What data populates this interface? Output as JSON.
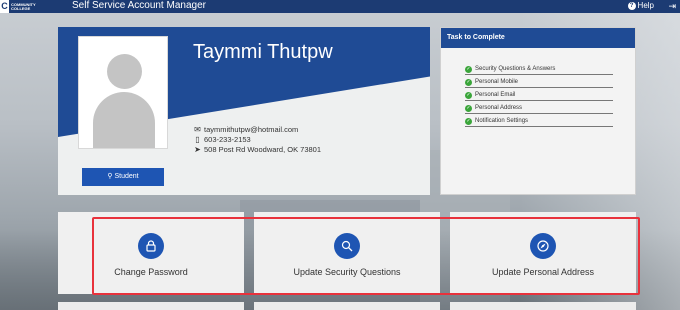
{
  "header": {
    "logo_line1": "COMMUNITY",
    "logo_line2": "COLLEGE",
    "logo_mark": "C",
    "title": "Self Service Account Manager",
    "help_label": "Help"
  },
  "profile": {
    "name": "Taymmi Thutpw",
    "email": "taymmithutpw@hotmail.com",
    "phone": "603-233-2153",
    "address": "508 Post Rd Woodward, OK 73801",
    "role_button": "Student"
  },
  "tasks": {
    "title": "Task to Complete",
    "items": [
      {
        "label": "Security Questions & Answers",
        "status": "complete"
      },
      {
        "label": "Personal Mobile",
        "status": "complete"
      },
      {
        "label": "Personal Email",
        "status": "complete"
      },
      {
        "label": "Personal Address",
        "status": "complete"
      },
      {
        "label": "Notification Settings",
        "status": "complete"
      }
    ]
  },
  "actions": [
    {
      "label": "Change Password",
      "icon": "lock-icon"
    },
    {
      "label": "Update Security Questions",
      "icon": "search-icon"
    },
    {
      "label": "Update Personal Address",
      "icon": "compass-icon"
    }
  ],
  "colors": {
    "topbar": "#1c3b73",
    "banner": "#1f4b95",
    "accent": "#1e55b3",
    "check": "#3aa53a",
    "highlight": "#e8323c"
  }
}
